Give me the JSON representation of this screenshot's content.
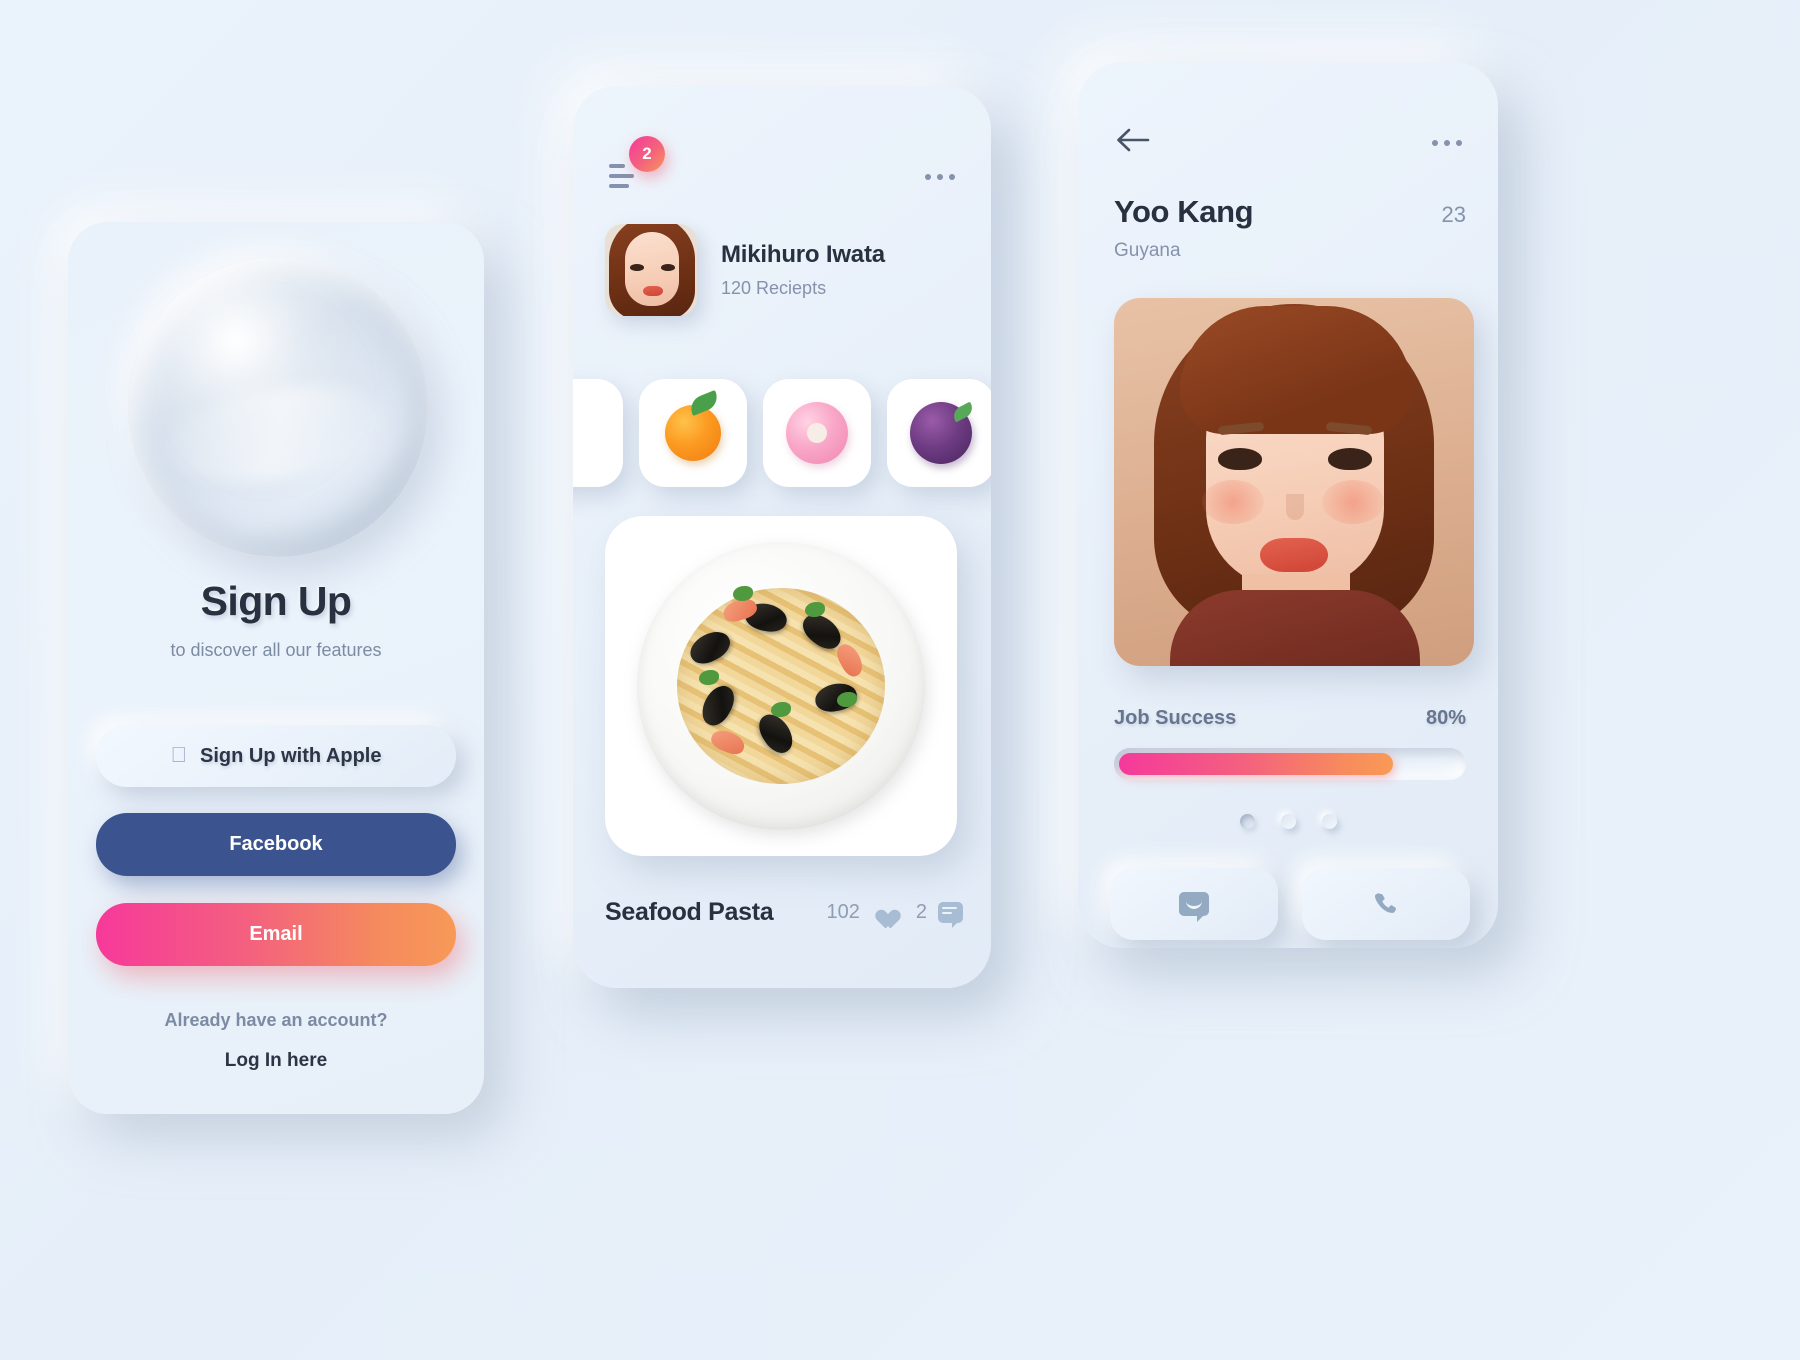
{
  "app": {
    "background_color": "#e8f1fa",
    "accent_gradient_start": "#f5399c",
    "accent_gradient_end": "#f89a56",
    "facebook_color": "#3b5490",
    "text_dark": "#28313f",
    "text_muted": "#8492ab"
  },
  "signup": {
    "logo_icon": "sphere-orb-logo",
    "title": "Sign Up",
    "subtitle": "to discover all our features",
    "apple_icon": "apple-icon",
    "apple_label": "Sign Up with Apple",
    "facebook_label": "Facebook",
    "email_label": "Email",
    "have_account": "Already have an account?",
    "login_link": "Log In here"
  },
  "recipe": {
    "menu_icon": "hamburger-menu-icon",
    "badge_count": "2",
    "more_icon": "more-horizontal-icon",
    "user_name": "Mikihuro Iwata",
    "user_meta": "120 Reciepts",
    "avatar_icon": "user-avatar",
    "categories": [
      {
        "name": "partial-left-card",
        "icon": "food-thumb-partial"
      },
      {
        "name": "mandarin-orange",
        "icon": "orange-fruit-icon"
      },
      {
        "name": "pink-donut",
        "icon": "donut-icon"
      },
      {
        "name": "berry-bowl",
        "icon": "berries-icon"
      },
      {
        "name": "partial-right-card",
        "icon": "food-thumb-partial"
      }
    ],
    "dish_image_name": "seafood-pasta-photo",
    "dish_title": "Seafood Pasta",
    "likes": "102",
    "like_icon": "heart-icon",
    "comments": "2",
    "comment_icon": "comment-bubble-icon"
  },
  "profile": {
    "back_icon": "back-arrow-icon",
    "more_icon": "more-horizontal-icon",
    "name": "Yoo Kang",
    "age": "23",
    "country": "Guyana",
    "portrait_name": "yoo-kang-portrait",
    "job_label": "Job Success",
    "job_percent": "80%",
    "progress_value": 80,
    "pager_dots": 3,
    "pager_active_index": 0,
    "message_icon": "message-icon",
    "call_icon": "phone-call-icon"
  }
}
